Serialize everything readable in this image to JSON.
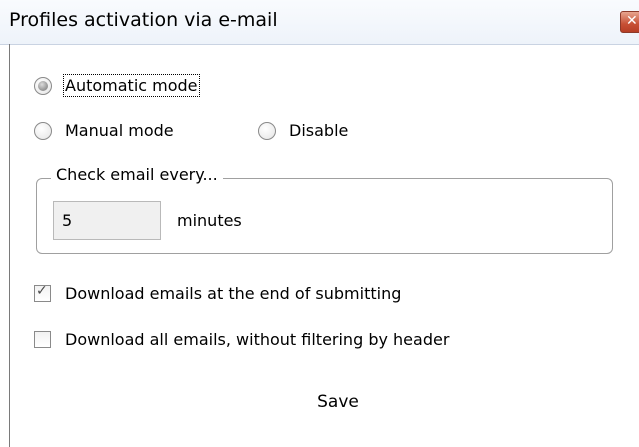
{
  "window": {
    "title": "Profiles activation via e-mail",
    "close_glyph": "✕"
  },
  "mode": {
    "automatic_label": "Automatic mode",
    "manual_label": "Manual mode",
    "disable_label": "Disable",
    "selected": "automatic"
  },
  "check_email": {
    "group_label": "Check email every...",
    "value": "5",
    "unit_label": "minutes"
  },
  "options": {
    "download_at_end_label": "Download emails at the end of submitting",
    "download_at_end_checked": true,
    "download_all_label": "Download all emails, without filtering by header",
    "download_all_checked": false
  },
  "actions": {
    "save_label": "Save"
  },
  "icons": {
    "check": "check-icon",
    "close": "close-icon"
  }
}
